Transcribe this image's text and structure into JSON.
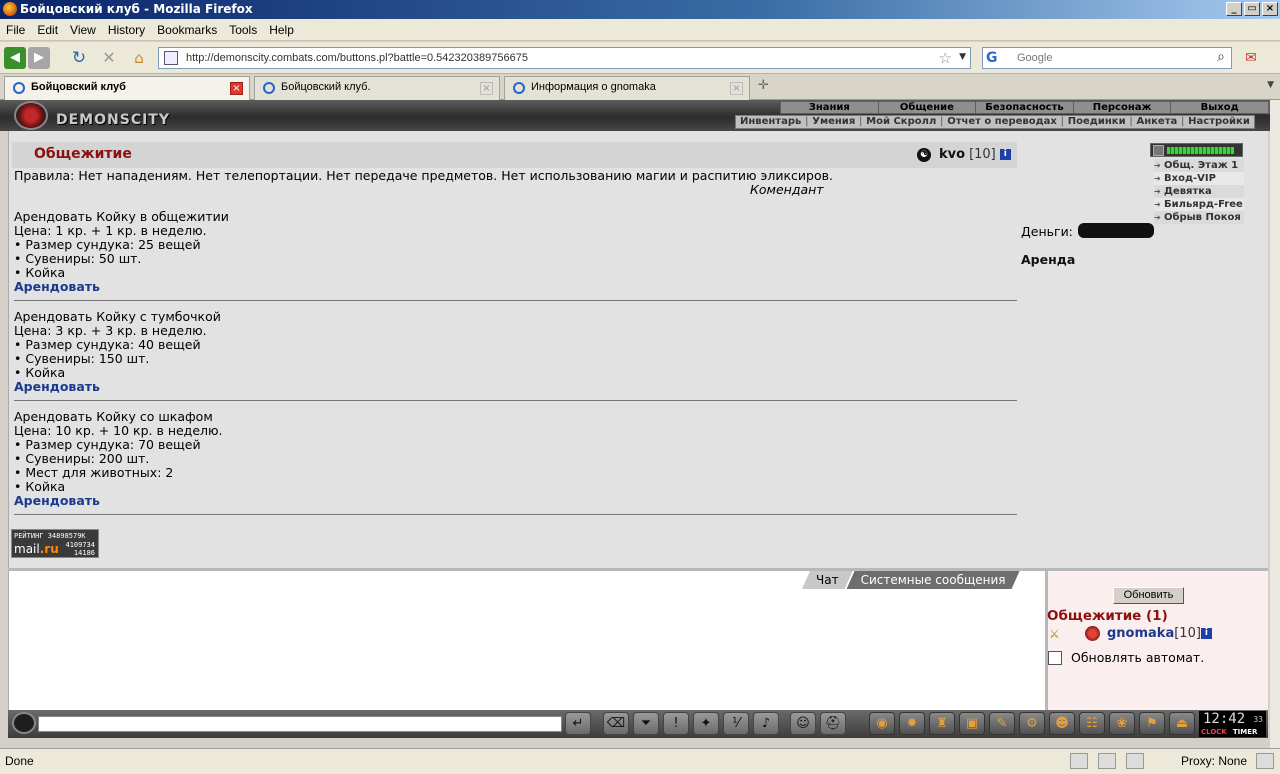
{
  "window": {
    "title": "Бойцовский клуб - Mozilla Firefox",
    "controls": [
      "_",
      "▭",
      "×"
    ]
  },
  "menu": [
    "File",
    "Edit",
    "View",
    "History",
    "Bookmarks",
    "Tools",
    "Help"
  ],
  "nav": {
    "url": "http://demonscity.combats.com/buttons.pl?battle=0.542320389756675",
    "search_placeholder": "Google"
  },
  "tabs": [
    {
      "label": "Бойцовский клуб",
      "active": true
    },
    {
      "label": "Бойцовский клуб.",
      "active": false
    },
    {
      "label": "Информация о gnomaka",
      "active": false
    }
  ],
  "game": {
    "logo": "DEMONSCITY",
    "nav_primary": [
      "Знания",
      "Общение",
      "Безопасность",
      "Персонаж",
      "Выход"
    ],
    "nav_secondary": [
      "Инвентарь",
      "Умения",
      "Мой Скролл",
      "Отчет о переводах",
      "Поединки",
      "Анкета",
      "Настройки"
    ],
    "place_title": "Общежитие",
    "user": {
      "nick": "kvo",
      "level": "[10]",
      "info": "i"
    },
    "rules": "Правила: Нет нападениям. Нет телепортации. Нет передаче предметов. Нет использованию магии и распитию эликсиров.",
    "commandant": "Комендант",
    "offers": [
      {
        "title": "Арендовать Койку в общежитии",
        "price": "Цена: 1 кр. + 1 кр. в неделю.",
        "features": [
          "• Размер сундука: 25 вещей",
          "• Сувениры: 50 шт.",
          "• Койка"
        ],
        "action": "Арендовать"
      },
      {
        "title": "Арендовать Койку с тумбочкой",
        "price": "Цена: 3 кр. + 3 кр. в неделю.",
        "features": [
          "• Размер сундука: 40 вещей",
          "• Сувениры: 150 шт.",
          "• Койка"
        ],
        "action": "Арендовать"
      },
      {
        "title": "Арендовать Койку со шкафом",
        "price": "Цена: 10 кр. + 10 кр. в неделю.",
        "features": [
          "• Размер сундука: 70 вещей",
          "• Сувениры: 200 шт.",
          "• Мест для животных: 2",
          "• Койка"
        ],
        "action": "Арендовать"
      }
    ],
    "rating": {
      "label": "РЕЙТИНГ 34898579К",
      "brand_a": "mail",
      "brand_b": ".ru",
      "n1": "4109734",
      "n2": "14186"
    },
    "health_fraction": 0.92,
    "locations": [
      "Общ. Этаж 1",
      "Вход-VIP",
      "Девятка",
      "Бильярд-Free",
      "Обрыв Покоя"
    ],
    "money_label": "Деньги:",
    "section_label": "Аренда"
  },
  "chat": {
    "tabs": [
      "Чат",
      "Системные сообщения"
    ],
    "refresh_button": "Обновить",
    "room": "Общежитие (1)",
    "player": {
      "nick": "gnomaka",
      "level": "[10]",
      "info": "i"
    },
    "auto_refresh_label": "Обновлять автомат."
  },
  "clock": {
    "time": "12:42",
    "seconds": "33",
    "clock_label": "CLOCK",
    "timer_label": "TIMER"
  },
  "status": {
    "text": "Done",
    "proxy": "Proxy: None"
  }
}
